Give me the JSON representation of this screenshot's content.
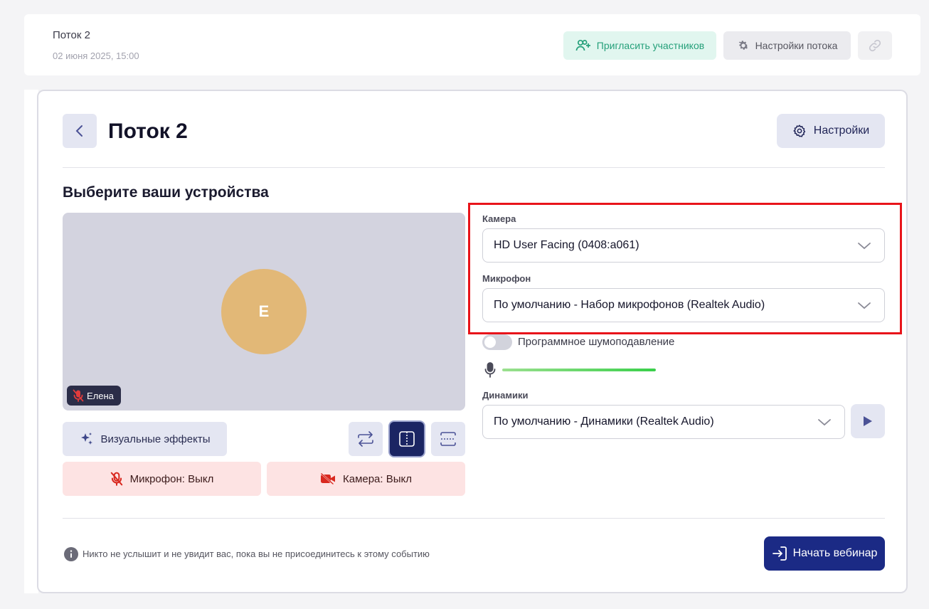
{
  "header": {
    "stream_title": "Поток 2",
    "stream_date": "02 июня 2025, 15:00",
    "invite_label": "Пригласить участников",
    "stream_settings_label": "Настройки потока"
  },
  "page": {
    "title": "Поток 2",
    "settings_label": "Настройки",
    "section_title": "Выберите ваши устройства"
  },
  "preview": {
    "avatar_letter": "E",
    "participant_name": "Елена"
  },
  "controls": {
    "effects_label": "Визуальные эффекты",
    "mic_off_label": "Микрофон: Выкл",
    "camera_off_label": "Камера: Выкл"
  },
  "devices": {
    "camera_label": "Камера",
    "camera_value": "HD User Facing (0408:a061)",
    "mic_label": "Микрофон",
    "mic_value": "По умолчанию - Набор микрофонов (Realtek Audio)",
    "noise_label": "Программное шумоподавление",
    "speakers_label": "Динамики",
    "speakers_value": "По умолчанию - Динамики (Realtek Audio)"
  },
  "mic_level_fraction": 1.0,
  "footer": {
    "info_text": "Никто не услышит и не увидит вас, пока вы не присоединитесь к этому событию",
    "start_label": "Начать вебинар"
  },
  "colors": {
    "accent": "#1b2a85",
    "highlight": "#e8141a",
    "avatar": "#e2b877",
    "danger_bg": "#fde3e3"
  },
  "icons": [
    "add-users-icon",
    "gear-icon",
    "link-icon",
    "chevron-left-icon",
    "sparkles-icon",
    "swap-icon",
    "split-view-icon",
    "crop-icon",
    "mic-off-icon",
    "camera-off-icon",
    "chevron-down-icon",
    "mic-icon",
    "play-icon",
    "info-icon",
    "enter-icon"
  ]
}
